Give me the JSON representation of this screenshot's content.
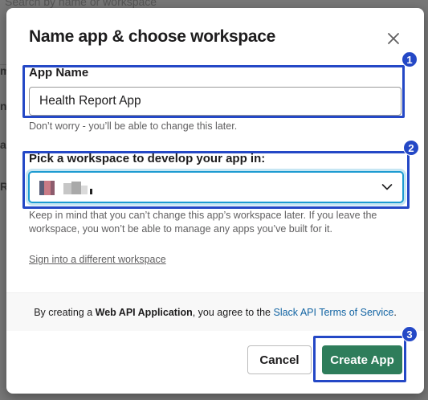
{
  "background": {
    "search_text": "Search by name or workspace",
    "frag_1": "m",
    "frag_2": "nl",
    "frag_3": "ai",
    "frag_4": "Re"
  },
  "dialog": {
    "title": "Name app & choose workspace",
    "close_icon": "close-icon"
  },
  "app_name": {
    "label": "App Name",
    "value": "Health Report App",
    "hint": "Don’t worry - you’ll be able to change this later."
  },
  "workspace": {
    "label": "Pick a workspace to develop your app in:",
    "selected_value": "",
    "hint": "Keep in mind that you can’t change this app’s workspace later. If you leave the workspace, you won’t be able to manage any apps you’ve built for it.",
    "sign_in_link": "Sign into a different workspace"
  },
  "terms": {
    "prefix": "By creating a ",
    "bold": "Web API Application",
    "middle": ", you agree to the ",
    "link": "Slack API Terms of Service",
    "suffix": "."
  },
  "buttons": {
    "cancel": "Cancel",
    "create": "Create App"
  },
  "callouts": [
    "1",
    "2",
    "3"
  ],
  "colors": {
    "create_button": "#2e7d5b",
    "callout": "#2448c6",
    "link": "#1264a3",
    "focus_ring": "#1d9bd1"
  }
}
